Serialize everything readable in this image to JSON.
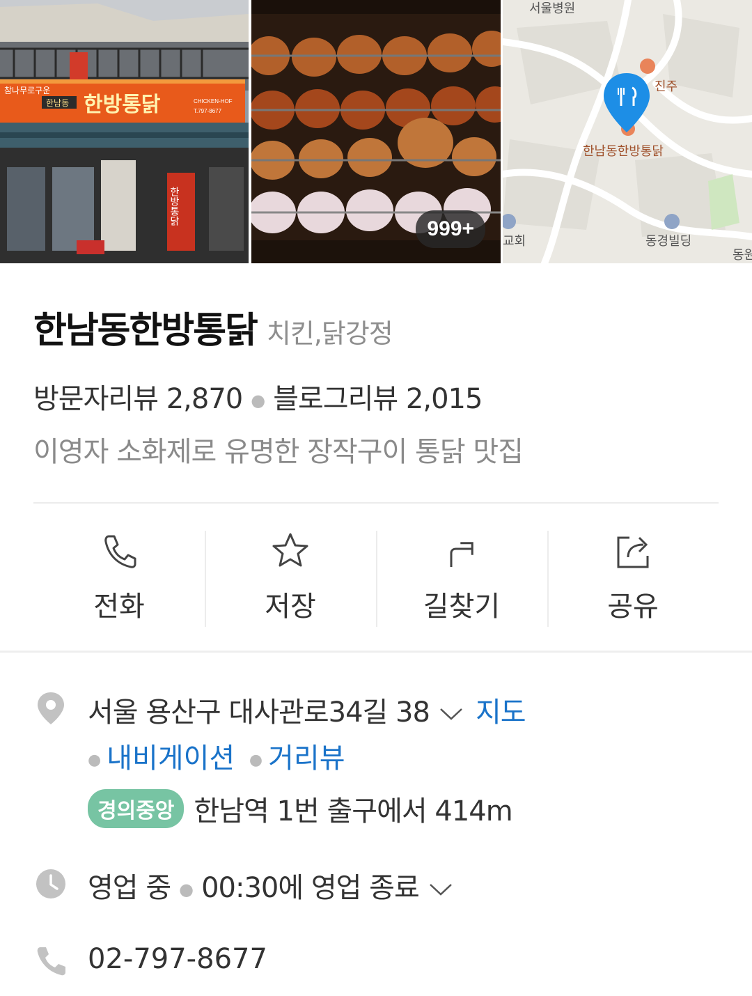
{
  "gallery": {
    "photo_count": "999+",
    "store_sign": {
      "slogan_small": "참나무로구운",
      "district_small": "한남동",
      "main_sign": "한방통닭",
      "english": "CHICKEN-HOF",
      "phone": "T.797-8677",
      "vertical_banner": "한방통닭"
    },
    "map": {
      "top_label": "서울병원",
      "place_label": "한남동한방통닭",
      "nearby_label": "진주",
      "building_label": "동경빌딩",
      "church_label": "교회",
      "edge_label": "동원"
    }
  },
  "place": {
    "name": "한남동한방통닭",
    "category": "치킨,닭강정",
    "visitor_reviews": "방문자리뷰 2,870",
    "blog_reviews": "블로그리뷰 2,015",
    "description": "이영자 소화제로 유명한 장작구이 통닭 맛집"
  },
  "actions": [
    {
      "label": "전화",
      "icon": "phone-icon"
    },
    {
      "label": "저장",
      "icon": "star-icon"
    },
    {
      "label": "길찾기",
      "icon": "directions-icon"
    },
    {
      "label": "공유",
      "icon": "share-icon"
    }
  ],
  "info": {
    "address": "서울 용산구 대사관로34길 38",
    "map_link": "지도",
    "navigation_link": "내비게이션",
    "street_view_link": "거리뷰",
    "subway_line": "경의중앙",
    "subway_distance": "한남역 1번 출구에서 414m",
    "status": "영업 중",
    "closing": "00:30에 영업 종료",
    "phone": "02-797-8677"
  },
  "colors": {
    "link": "#1a73c9",
    "subway_badge": "#77c4a3",
    "map_pin": "#1d8ee6",
    "muted_text": "#8a8a8a"
  }
}
